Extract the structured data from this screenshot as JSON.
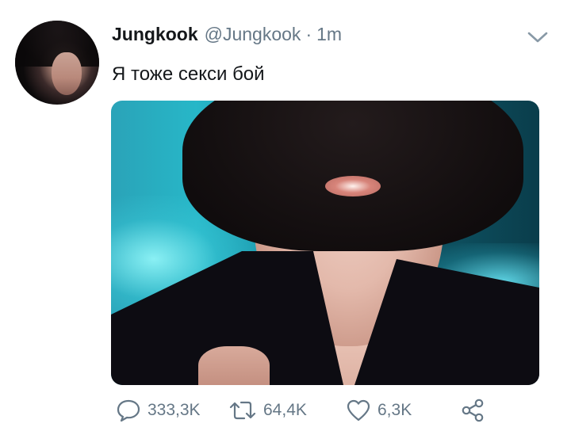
{
  "tweet": {
    "author": {
      "display_name": "Jungkook",
      "handle": "@Jungkook",
      "avatar": "profile-photo"
    },
    "separator": "·",
    "timestamp": "1m",
    "text": "Я тоже секси бой",
    "media": "photo"
  },
  "actions": {
    "reply": {
      "icon": "reply-icon",
      "count": "333,3K"
    },
    "retweet": {
      "icon": "retweet-icon",
      "count": "64,4K"
    },
    "like": {
      "icon": "heart-icon",
      "count": "6,3K"
    },
    "share": {
      "icon": "share-icon"
    }
  },
  "menu": {
    "icon": "chevron-down-icon"
  },
  "colors": {
    "text": "#14171a",
    "secondary": "#657786",
    "background": "#ffffff"
  }
}
